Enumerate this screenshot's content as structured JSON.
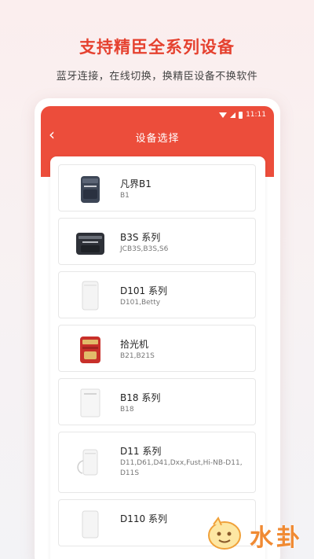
{
  "header": {
    "title": "支持精臣全系列设备",
    "subtitle": "蓝牙连接，在线切换，换精臣设备不换软件"
  },
  "status_bar": {
    "time": "11:11"
  },
  "app": {
    "title": "设备选择",
    "back_glyph": "‹"
  },
  "devices": [
    {
      "name": "凡界B1",
      "models": "B1",
      "icon": "printer-b1-icon"
    },
    {
      "name": "B3S 系列",
      "models": "JCB3S,B3S,S6",
      "icon": "printer-b3s-icon"
    },
    {
      "name": "D101 系列",
      "models": "D101,Betty",
      "icon": "printer-d101-icon"
    },
    {
      "name": "拾光机",
      "models": "B21,B21S",
      "icon": "printer-b21-icon"
    },
    {
      "name": "B18 系列",
      "models": "B18",
      "icon": "printer-b18-icon"
    },
    {
      "name": "D11 系列",
      "models": "D11,D61,D41,Dxx,Fust,Hi-NB-D11,\nD11S",
      "icon": "printer-d11-icon"
    },
    {
      "name": "D110 系列",
      "models": "",
      "icon": "printer-d110-icon"
    }
  ],
  "watermark": {
    "text": "水卦",
    "icon": "mascot-icon"
  },
  "colors": {
    "brand_red": "#ec4d3b",
    "headline_red": "#e5412f"
  }
}
